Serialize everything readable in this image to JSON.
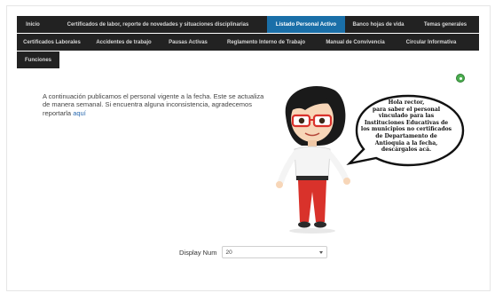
{
  "nav": {
    "row1": [
      {
        "label": "Inicio",
        "active": false
      },
      {
        "label": "Certificados de labor, reporte de novedades y situaciones disciplinarias",
        "active": false
      },
      {
        "label": "Listado Personal Activo",
        "active": true
      },
      {
        "label": "Banco hojas de vida",
        "active": false
      },
      {
        "label": "Temas generales",
        "active": false
      }
    ],
    "row2": [
      {
        "label": "Certificados Laborales"
      },
      {
        "label": "Accidentes de trabajo"
      },
      {
        "label": "Pausas Activas"
      },
      {
        "label": "Reglamento Interno de Trabajo"
      },
      {
        "label": "Manual de Convivencia"
      },
      {
        "label": "Circular Informativa"
      }
    ],
    "row3": [
      {
        "label": "Funciones"
      }
    ]
  },
  "intro": {
    "text": "A continuación publicamos el personal vigente a la fecha. Este se actualiza de manera semanal. Si encuentra alguna inconsistencia, agradecemos reportarla ",
    "link": "aquí"
  },
  "bubble": {
    "lines": [
      "Hola rector,",
      "para saber el personal",
      "vinculado para las",
      "Instituciones Educativas de",
      "los municipios no certificados",
      "de Departamento de",
      "Antioquia a la fecha,",
      "descárgalos acá."
    ]
  },
  "display": {
    "label": "Display Num",
    "value": "20"
  },
  "colors": {
    "nav_bg": "#222222",
    "nav_active": "#1a6fa8",
    "link": "#2a6ab0",
    "status_green": "#4caf50"
  },
  "icons": {
    "status": "green-circle-icon",
    "select_caret": "caret-down-icon"
  }
}
